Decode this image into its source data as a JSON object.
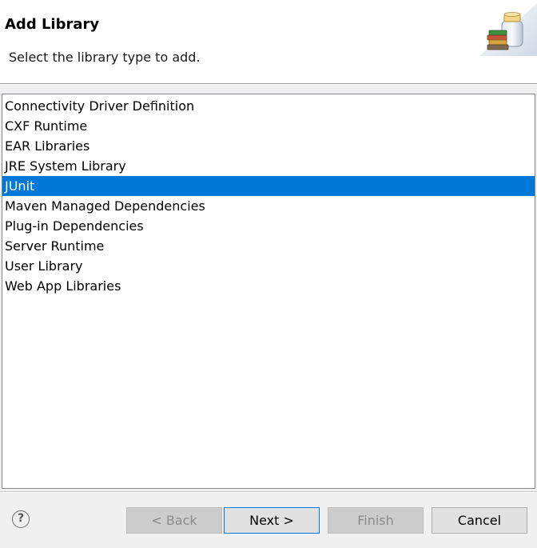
{
  "header": {
    "title": "Add Library",
    "subtitle": "Select the library type to add.",
    "icon": "library-jar-books-icon"
  },
  "library_types": {
    "items": [
      "Connectivity Driver Definition",
      "CXF Runtime",
      "EAR Libraries",
      "JRE System Library",
      "JUnit",
      "Maven Managed Dependencies",
      "Plug-in Dependencies",
      "Server Runtime",
      "User Library",
      "Web App Libraries"
    ],
    "selected": "JUnit"
  },
  "footer": {
    "help_icon": "help-icon",
    "help_glyph": "?",
    "back_label": "< Back",
    "next_label": "Next >",
    "finish_label": "Finish",
    "cancel_label": "Cancel"
  },
  "colors": {
    "selection": "#0078d7",
    "default_button_border": "#0078d7"
  }
}
